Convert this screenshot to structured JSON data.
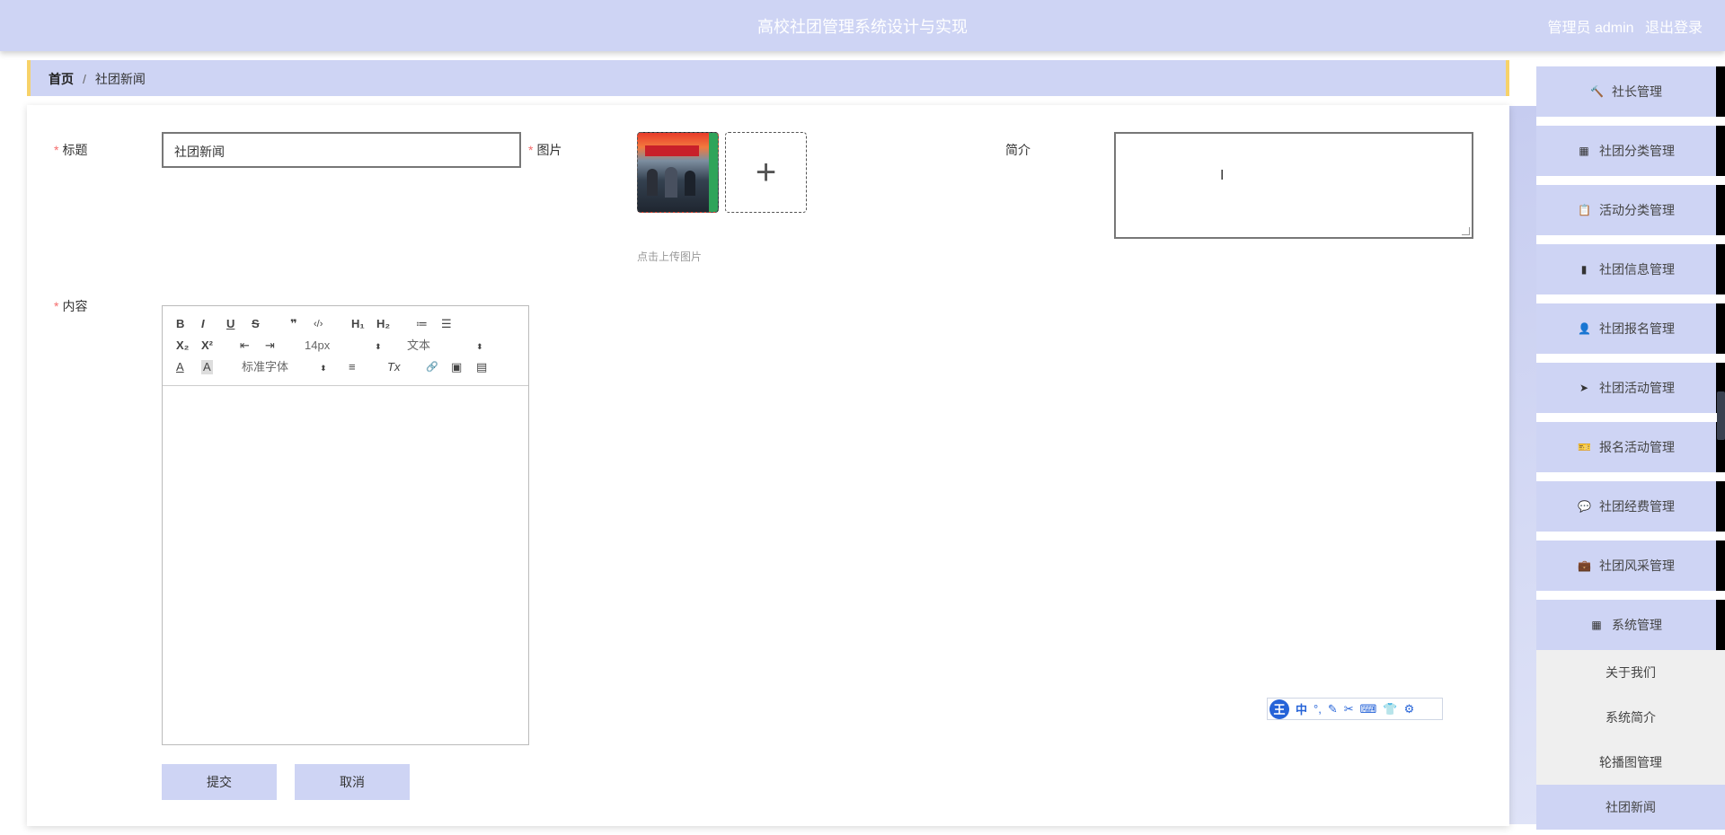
{
  "header": {
    "title": "高校社团管理系统设计与实现",
    "user_label": "管理员 admin",
    "logout_label": "退出登录"
  },
  "breadcrumb": {
    "home": "首页",
    "separator": "/",
    "current": "社团新闻"
  },
  "form": {
    "required_mark": "*",
    "title_label": "标题",
    "title_value": "社团新闻",
    "image_label": "图片",
    "upload_plus": "+",
    "upload_hint": "点击上传图片",
    "intro_label": "简介",
    "intro_value": "",
    "content_label": "内容",
    "submit_label": "提交",
    "cancel_label": "取消"
  },
  "editor": {
    "bold": "B",
    "italic": "I",
    "underline": "U",
    "strike": "S",
    "quote": "❞",
    "code": "‹/›",
    "h1": "H₁",
    "h2": "H₂",
    "ol": "≔",
    "ul": "☰",
    "sub": "X₂",
    "sup": "X²",
    "outdent": "⇤",
    "indent": "⇥",
    "size_value": "14px",
    "header_value": "文本",
    "font_value": "标准字体",
    "select_arrow": "⬍",
    "color": "A",
    "background": "A",
    "align": "≡",
    "clean": "Tx",
    "link": "🔗",
    "image": "▣",
    "video": "▤"
  },
  "sidebar": {
    "items": [
      {
        "label": "社长管理",
        "icon": "gavel-icon"
      },
      {
        "label": "社团分类管理",
        "icon": "grid-icon"
      },
      {
        "label": "活动分类管理",
        "icon": "clipboard-icon"
      },
      {
        "label": "社团信息管理",
        "icon": "bar-chart-icon"
      },
      {
        "label": "社团报名管理",
        "icon": "user-icon"
      },
      {
        "label": "社团活动管理",
        "icon": "send-icon"
      },
      {
        "label": "报名活动管理",
        "icon": "ticket-icon"
      },
      {
        "label": "社团经费管理",
        "icon": "comment-icon"
      },
      {
        "label": "社团风采管理",
        "icon": "briefcase-icon"
      },
      {
        "label": "系统管理",
        "icon": "grid-icon"
      }
    ],
    "icon_glyphs": [
      "🔨",
      "▦",
      "📋",
      "▮",
      "👤",
      "➤",
      "🎫",
      "💬",
      "💼",
      "▦"
    ],
    "subitems": [
      {
        "label": "关于我们"
      },
      {
        "label": "系统简介"
      },
      {
        "label": "轮播图管理"
      },
      {
        "label": "社团新闻"
      }
    ]
  },
  "ime": {
    "logo": "王",
    "mode": "中",
    "icons": [
      "°,",
      "✎",
      "✂",
      "⌨",
      "👕",
      "⚙"
    ]
  }
}
